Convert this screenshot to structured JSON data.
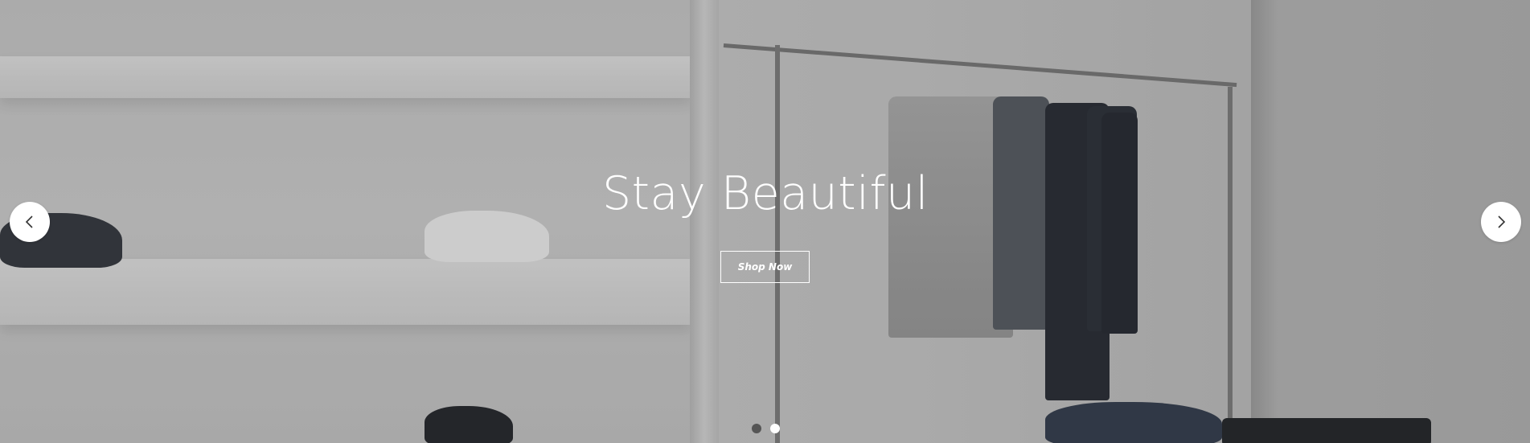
{
  "hero": {
    "title": "Stay Beautiful",
    "cta_label": "Shop Now"
  },
  "slider": {
    "prev_icon": "chevron-left-icon",
    "next_icon": "chevron-right-icon",
    "slide_count": 2,
    "active_slide": 2
  },
  "colors": {
    "text": "#ffffff",
    "arrow_bg": "#ffffff",
    "dot_inactive": "#555555",
    "dot_active": "#ffffff"
  }
}
